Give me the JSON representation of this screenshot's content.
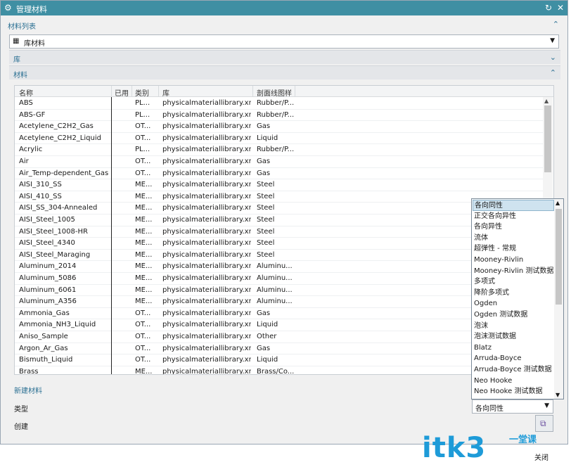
{
  "titlebar": {
    "title": "管理材料",
    "reset_icon": "reset-icon",
    "close_icon": "close-icon"
  },
  "material_list": {
    "header": "材料列表",
    "library_select": {
      "value": "库材料",
      "icon": "library-icon"
    }
  },
  "library_bar": {
    "label": "库"
  },
  "materials_bar": {
    "label": "材料"
  },
  "table": {
    "columns": [
      "名称",
      "已用",
      "类别",
      "库",
      "剖面线图样"
    ],
    "rows": [
      [
        "ABS",
        "",
        "PL...",
        "physicalmateriallibrary.xml",
        "Rubber/P..."
      ],
      [
        "ABS-GF",
        "",
        "PL...",
        "physicalmateriallibrary.xml",
        "Rubber/P..."
      ],
      [
        "Acetylene_C2H2_Gas",
        "",
        "OT...",
        "physicalmateriallibrary.xml",
        "Gas"
      ],
      [
        "Acetylene_C2H2_Liquid",
        "",
        "OT...",
        "physicalmateriallibrary.xml",
        "Liquid"
      ],
      [
        "Acrylic",
        "",
        "PL...",
        "physicalmateriallibrary.xml",
        "Rubber/P..."
      ],
      [
        "Air",
        "",
        "OT...",
        "physicalmateriallibrary.xml",
        "Gas"
      ],
      [
        "Air_Temp-dependent_Gas",
        "",
        "OT...",
        "physicalmateriallibrary.xml",
        "Gas"
      ],
      [
        "AISI_310_SS",
        "",
        "ME...",
        "physicalmateriallibrary.xml",
        "Steel"
      ],
      [
        "AISI_410_SS",
        "",
        "ME...",
        "physicalmateriallibrary.xml",
        "Steel"
      ],
      [
        "AISI_SS_304-Annealed",
        "",
        "ME...",
        "physicalmateriallibrary.xml",
        "Steel"
      ],
      [
        "AISI_Steel_1005",
        "",
        "ME...",
        "physicalmateriallibrary.xml",
        "Steel"
      ],
      [
        "AISI_Steel_1008-HR",
        "",
        "ME...",
        "physicalmateriallibrary.xml",
        "Steel"
      ],
      [
        "AISI_Steel_4340",
        "",
        "ME...",
        "physicalmateriallibrary.xml",
        "Steel"
      ],
      [
        "AISI_Steel_Maraging",
        "",
        "ME...",
        "physicalmateriallibrary.xml",
        "Steel"
      ],
      [
        "Aluminum_2014",
        "",
        "ME...",
        "physicalmateriallibrary.xml",
        "Aluminu..."
      ],
      [
        "Aluminum_5086",
        "",
        "ME...",
        "physicalmateriallibrary.xml",
        "Aluminu..."
      ],
      [
        "Aluminum_6061",
        "",
        "ME...",
        "physicalmateriallibrary.xml",
        "Aluminu..."
      ],
      [
        "Aluminum_A356",
        "",
        "ME...",
        "physicalmateriallibrary.xml",
        "Aluminu..."
      ],
      [
        "Ammonia_Gas",
        "",
        "OT...",
        "physicalmateriallibrary.xml",
        "Gas"
      ],
      [
        "Ammonia_NH3_Liquid",
        "",
        "OT...",
        "physicalmateriallibrary.xml",
        "Liquid"
      ],
      [
        "Aniso_Sample",
        "",
        "OT...",
        "physicalmateriallibrary.xml",
        "Other"
      ],
      [
        "Argon_Ar_Gas",
        "",
        "OT...",
        "physicalmateriallibrary.xml",
        "Gas"
      ],
      [
        "Bismuth_Liquid",
        "",
        "OT...",
        "physicalmateriallibrary.xml",
        "Liquid"
      ],
      [
        "Brass",
        "",
        "ME...",
        "physicalmateriallibrary.xml",
        "Brass/Co..."
      ]
    ]
  },
  "type_dropdown": {
    "options": [
      "各向同性",
      "正交各向异性",
      "各向异性",
      "流体",
      "超弹性 - 常规",
      "Mooney-Rivlin",
      "Mooney-Rivlin 测试数据",
      "多项式",
      "降阶多项式",
      "Ogden",
      "Ogden 测试数据",
      "泡沫",
      "泡沫测试数据",
      "Blatz",
      "Arruda-Boyce",
      "Arruda-Boyce 测试数据",
      "Neo Hooke",
      "Neo Hooke 测试数据"
    ],
    "selected": "各向同性"
  },
  "new_material": {
    "header": "新建材料",
    "type_label": "类型",
    "type_value": "各向同性",
    "create_label": "创建",
    "create_icon": "create-material-icon"
  },
  "watermark": {
    "text": "itk3",
    "sub": "一堂课"
  },
  "footer": {
    "close_label": "关闭"
  },
  "colors": {
    "titlebar": "#3f8fa3",
    "accent": "#2a6f92",
    "selection": "#cfe3ef"
  }
}
